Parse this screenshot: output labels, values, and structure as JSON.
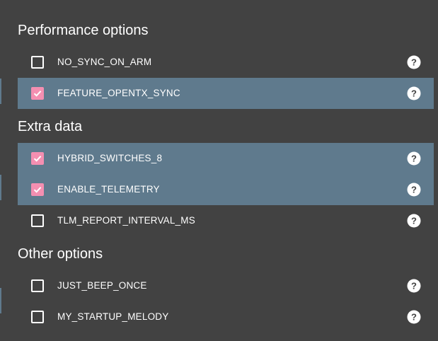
{
  "sections": [
    {
      "title": "Performance options",
      "items": [
        {
          "label": "NO_SYNC_ON_ARM",
          "checked": false
        },
        {
          "label": "FEATURE_OPENTX_SYNC",
          "checked": true
        }
      ]
    },
    {
      "title": "Extra data",
      "items": [
        {
          "label": "HYBRID_SWITCHES_8",
          "checked": true
        },
        {
          "label": "ENABLE_TELEMETRY",
          "checked": true
        },
        {
          "label": "TLM_REPORT_INTERVAL_MS",
          "checked": false
        }
      ]
    },
    {
      "title": "Other options",
      "items": [
        {
          "label": "JUST_BEEP_ONCE",
          "checked": false
        },
        {
          "label": "MY_STARTUP_MELODY",
          "checked": false
        }
      ]
    }
  ],
  "icons": {
    "help": "help-icon",
    "check": "checkmark-icon"
  },
  "colors": {
    "background": "#424242",
    "row_highlight": "#5f7a8d",
    "checkbox_accent": "#f48fb1"
  }
}
